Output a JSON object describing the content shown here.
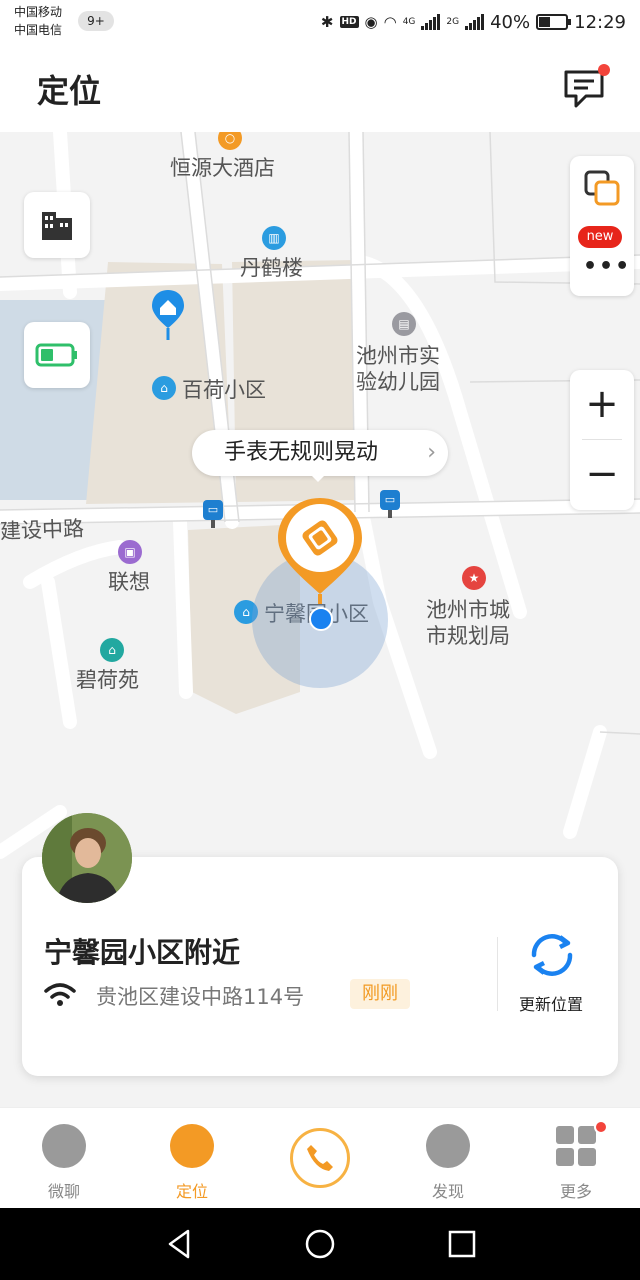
{
  "status_bar": {
    "carrier1": "中国移动",
    "carrier2": "中国电信",
    "notif_count": "9+",
    "net1": "4G",
    "net2": "2G",
    "battery": "40%",
    "time": "12:29"
  },
  "header": {
    "title": "定位",
    "message_icon": "message-icon"
  },
  "map": {
    "pois": {
      "hotel": "恒源大酒店",
      "danhe": "丹鹤楼",
      "kindergarten_l1": "池州市实",
      "kindergarten_l2": "验幼儿园",
      "baihe": "百荷小区",
      "road": "建设中路",
      "lianxiang": "联想",
      "ningxin": "宁馨园小区",
      "planning_l1": "池州市城",
      "planning_l2": "市规划局",
      "bihe": "碧荷苑"
    },
    "alert_text": "手表无规则晃动",
    "new_badge": "new",
    "zoom_in": "+",
    "zoom_out": "−"
  },
  "card": {
    "location_title": "宁馨园小区附近",
    "address": "贵池区建设中路114号",
    "time_badge": "刚刚",
    "refresh_label": "更新位置"
  },
  "tabs": [
    {
      "label": "微聊",
      "icon": "chat-icon"
    },
    {
      "label": "定位",
      "icon": "location-icon",
      "active": true
    },
    {
      "label": "",
      "icon": "phone-icon"
    },
    {
      "label": "发现",
      "icon": "discover-icon"
    },
    {
      "label": "更多",
      "icon": "more-grid-icon"
    }
  ],
  "colors": {
    "accent": "#f39a25",
    "badge_red": "#f3443b",
    "blue": "#1a82f0"
  }
}
